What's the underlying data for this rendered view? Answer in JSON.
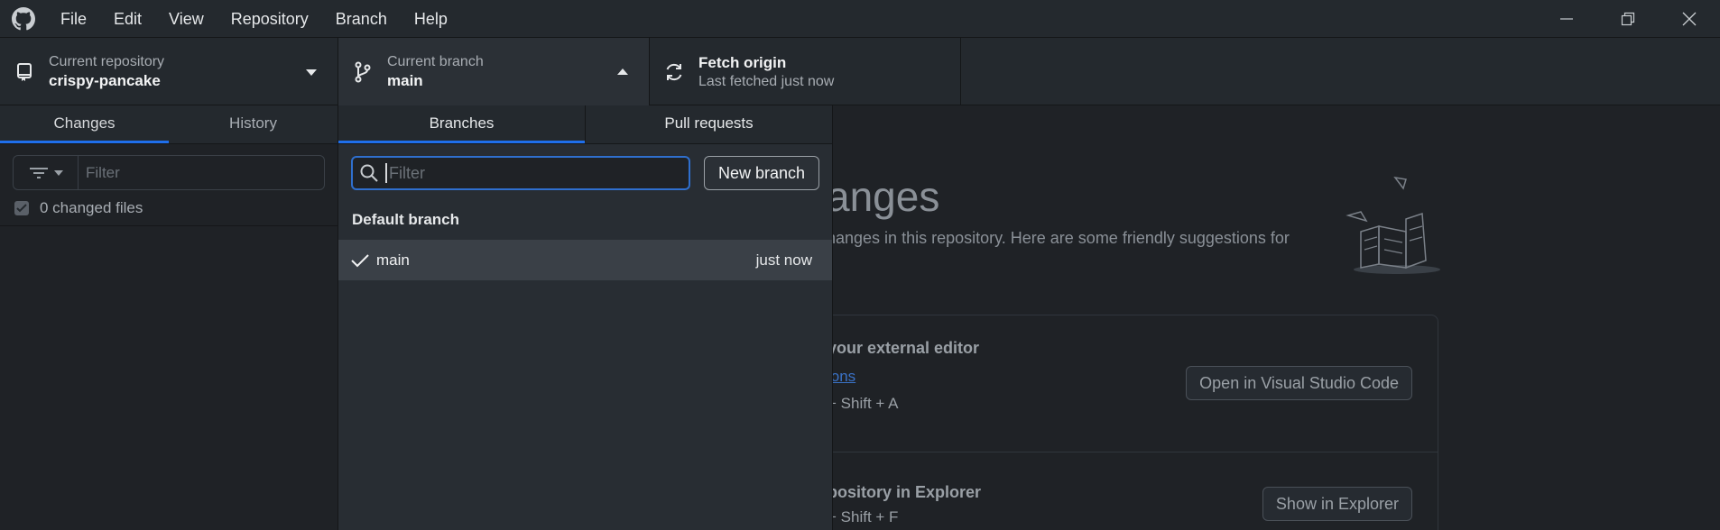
{
  "menu": [
    "File",
    "Edit",
    "View",
    "Repository",
    "Branch",
    "Help"
  ],
  "toolbar": {
    "repository": {
      "label": "Current repository",
      "value": "crispy-pancake"
    },
    "branch": {
      "label": "Current branch",
      "value": "main"
    },
    "fetch": {
      "label": "Fetch origin",
      "value": "Last fetched just now"
    }
  },
  "sidebar": {
    "tabs": [
      "Changes",
      "History"
    ],
    "filter_placeholder": "Filter",
    "changed_files": "0 changed files"
  },
  "main": {
    "heading": "anges",
    "subtext": "hanges in this repository. Here are some friendly suggestions for",
    "editor": {
      "title": "your external editor",
      "link": "ions",
      "keys": "+ Shift +  A",
      "button": "Open in Visual Studio Code"
    },
    "explorer": {
      "title": "pository in Explorer",
      "keys": "+ Shift +  F",
      "button": "Show in Explorer"
    }
  },
  "dropdown": {
    "tabs": [
      "Branches",
      "Pull requests"
    ],
    "filter_placeholder": "Filter",
    "new_branch": "New branch",
    "section_label": "Default branch",
    "branches": [
      {
        "name": "main",
        "time": "just now",
        "selected": true
      }
    ]
  },
  "colors": {
    "accent": "#1f6feb",
    "focus": "#2f6fce"
  }
}
